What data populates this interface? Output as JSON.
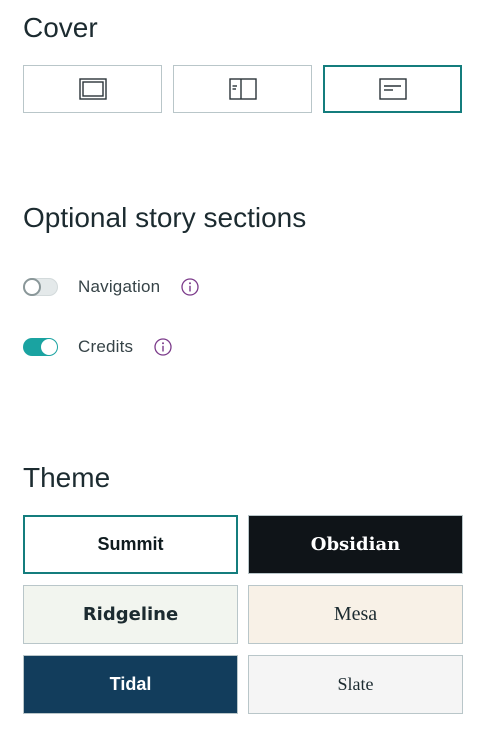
{
  "cover": {
    "title": "Cover",
    "options": [
      {
        "name": "full",
        "selected": false
      },
      {
        "name": "sidebyside",
        "selected": false
      },
      {
        "name": "minimal",
        "selected": true
      }
    ]
  },
  "sections": {
    "title": "Optional story sections",
    "items": [
      {
        "label": "Navigation",
        "enabled": false
      },
      {
        "label": "Credits",
        "enabled": true
      }
    ]
  },
  "theme": {
    "title": "Theme",
    "tiles": [
      {
        "label": "Summit",
        "bg": "#ffffff",
        "color": "#0f1b1f",
        "selected": true
      },
      {
        "label": "Obsidian",
        "bg": "#0f1418",
        "color": "#ffffff",
        "selected": false
      },
      {
        "label": "Ridgeline",
        "bg": "#f2f5ef",
        "color": "#1c2b30",
        "selected": false
      },
      {
        "label": "Mesa",
        "bg": "#f8f1e7",
        "color": "#1c2b30",
        "selected": false
      },
      {
        "label": "Tidal",
        "bg": "#123d5c",
        "color": "#ffffff",
        "selected": false
      },
      {
        "label": "Slate",
        "bg": "#f5f5f5",
        "color": "#1c2b30",
        "selected": false
      }
    ]
  },
  "colors": {
    "accent": "#147d7d",
    "toggle_on": "#1aa3a1",
    "info_icon": "#7b3a8a"
  }
}
